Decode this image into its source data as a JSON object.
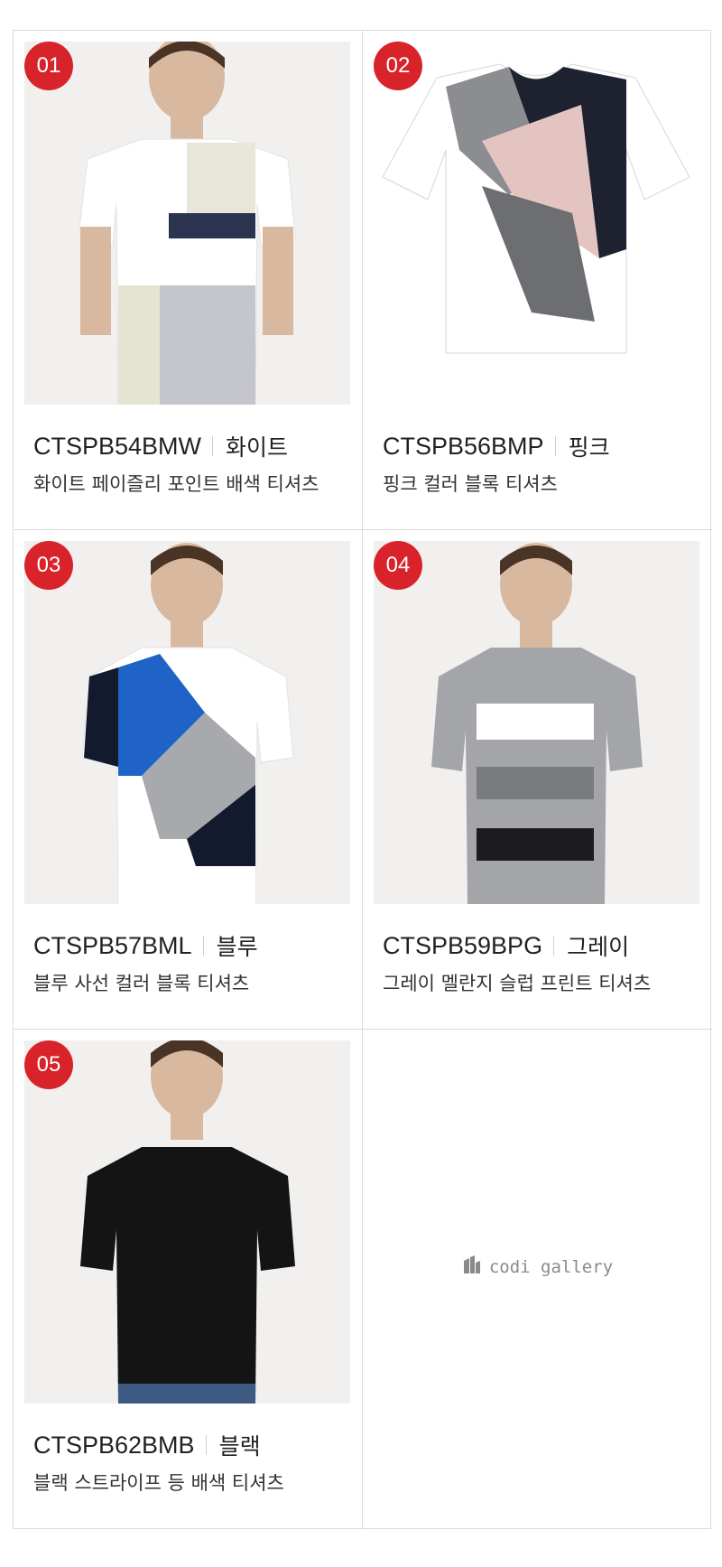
{
  "products": [
    {
      "number": "01",
      "code": "CTSPB54BMW",
      "color": "화이트",
      "description": "화이트 페이즐리 포인트 배색 티셔츠"
    },
    {
      "number": "02",
      "code": "CTSPB56BMP",
      "color": "핑크",
      "description": "핑크 컬러 블록 티셔츠"
    },
    {
      "number": "03",
      "code": "CTSPB57BML",
      "color": "블루",
      "description": "블루 사선 컬러 블록 티셔츠"
    },
    {
      "number": "04",
      "code": "CTSPB59BPG",
      "color": "그레이",
      "description": "그레이 멜란지 슬럽 프린트 티셔츠"
    },
    {
      "number": "05",
      "code": "CTSPB62BMB",
      "color": "블랙",
      "description": "블랙 스트라이프 등 배색 티셔츠"
    }
  ],
  "brand": {
    "logo_text": "codi gallery",
    "logo_icon": "building-icon"
  },
  "colors": {
    "badge": "#d8232a",
    "border": "#dcdcdc",
    "logo": "#8a8a8a"
  }
}
